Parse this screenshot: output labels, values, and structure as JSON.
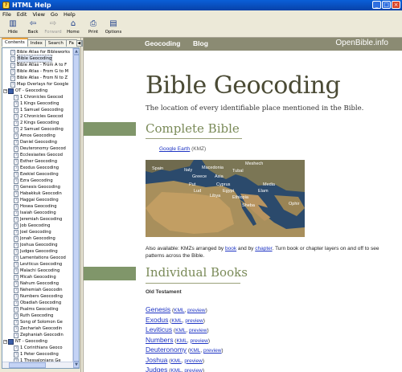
{
  "window": {
    "title": "HTML Help",
    "menu": [
      "File",
      "Edit",
      "View",
      "Go",
      "Help"
    ],
    "toolbar": [
      {
        "label": "Hide",
        "icon": "hide-icon",
        "enabled": true
      },
      {
        "label": "Back",
        "icon": "back-arrow-icon",
        "enabled": true
      },
      {
        "label": "Forward",
        "icon": "forward-arrow-icon",
        "enabled": false
      },
      {
        "label": "Home",
        "icon": "home-icon",
        "enabled": true
      },
      {
        "label": "Print",
        "icon": "printer-icon",
        "enabled": true
      },
      {
        "label": "Options",
        "icon": "options-icon",
        "enabled": true
      }
    ]
  },
  "nav": {
    "tabs": [
      "Contents",
      "Index",
      "Search",
      "Fa"
    ],
    "tree": [
      {
        "label": "Bible Atlas for Bibleworks",
        "type": "page",
        "depth": 1
      },
      {
        "label": "Bible Geocoding",
        "type": "page",
        "depth": 1,
        "selected": true
      },
      {
        "label": "Bible Atlas - From A to F",
        "type": "page",
        "depth": 1
      },
      {
        "label": "Bible Atlas - From G to M",
        "type": "page",
        "depth": 1
      },
      {
        "label": "Bible Atlas - From N to Z",
        "type": "page",
        "depth": 1
      },
      {
        "label": "Map Overlays for Google",
        "type": "page",
        "depth": 1
      },
      {
        "label": "OT - Geocoding",
        "type": "book",
        "depth": 0
      },
      {
        "label": "1 Chronicles Geocod",
        "type": "page",
        "depth": 2
      },
      {
        "label": "1 Kings Geocoding",
        "type": "page",
        "depth": 2
      },
      {
        "label": "1 Samuel Geocoding",
        "type": "page",
        "depth": 2
      },
      {
        "label": "2 Chronicles Geocod",
        "type": "page",
        "depth": 2
      },
      {
        "label": "2 Kings Geocoding",
        "type": "page",
        "depth": 2
      },
      {
        "label": "2 Samuel Geocoding",
        "type": "page",
        "depth": 2
      },
      {
        "label": "Amos Geocoding",
        "type": "page",
        "depth": 2
      },
      {
        "label": "Daniel Geocoding",
        "type": "page",
        "depth": 2
      },
      {
        "label": "Deuteronomy Geocod",
        "type": "page",
        "depth": 2
      },
      {
        "label": "Ecclesiastes Geocod",
        "type": "page",
        "depth": 2
      },
      {
        "label": "Esther Geocoding",
        "type": "page",
        "depth": 2
      },
      {
        "label": "Exodus Geocoding",
        "type": "page",
        "depth": 2
      },
      {
        "label": "Ezekiel Geocoding",
        "type": "page",
        "depth": 2
      },
      {
        "label": "Ezra Geocoding",
        "type": "page",
        "depth": 2
      },
      {
        "label": "Genesis Geocoding",
        "type": "page",
        "depth": 2
      },
      {
        "label": "Habakkuk Geocodin",
        "type": "page",
        "depth": 2
      },
      {
        "label": "Haggai Geocoding",
        "type": "page",
        "depth": 2
      },
      {
        "label": "Hosea Geocoding",
        "type": "page",
        "depth": 2
      },
      {
        "label": "Isaiah Geocoding",
        "type": "page",
        "depth": 2
      },
      {
        "label": "Jeremiah Geocoding",
        "type": "page",
        "depth": 2
      },
      {
        "label": "Job Geocoding",
        "type": "page",
        "depth": 2
      },
      {
        "label": "Joel Geocoding",
        "type": "page",
        "depth": 2
      },
      {
        "label": "Jonah Geocoding",
        "type": "page",
        "depth": 2
      },
      {
        "label": "Joshua Geocoding",
        "type": "page",
        "depth": 2
      },
      {
        "label": "Judges Geocoding",
        "type": "page",
        "depth": 2
      },
      {
        "label": "Lamentations Geocod",
        "type": "page",
        "depth": 2
      },
      {
        "label": "Leviticus Geocoding",
        "type": "page",
        "depth": 2
      },
      {
        "label": "Malachi Geocoding",
        "type": "page",
        "depth": 2
      },
      {
        "label": "Micah Geocoding",
        "type": "page",
        "depth": 2
      },
      {
        "label": "Nahum Geocoding",
        "type": "page",
        "depth": 2
      },
      {
        "label": "Nehemiah Geocodin",
        "type": "page",
        "depth": 2
      },
      {
        "label": "Numbers Geocoding",
        "type": "page",
        "depth": 2
      },
      {
        "label": "Obadiah Geocoding",
        "type": "page",
        "depth": 2
      },
      {
        "label": "Psalms Geocoding",
        "type": "page",
        "depth": 2
      },
      {
        "label": "Ruth Geocoding",
        "type": "page",
        "depth": 2
      },
      {
        "label": "Song of Solomon Ge",
        "type": "page",
        "depth": 2
      },
      {
        "label": "Zechariah Geocodin",
        "type": "page",
        "depth": 2
      },
      {
        "label": "Zephaniah Geocodin",
        "type": "page",
        "depth": 2
      },
      {
        "label": "NT - Geocoding",
        "type": "book",
        "depth": 0
      },
      {
        "label": "1 Corinthians Geoco",
        "type": "page",
        "depth": 2
      },
      {
        "label": "1 Peter Geocoding",
        "type": "page",
        "depth": 2
      },
      {
        "label": "1 Thessalonians Ge",
        "type": "page",
        "depth": 2
      }
    ]
  },
  "page": {
    "site_nav": [
      "Geocoding",
      "Blog"
    ],
    "brand": "OpenBible.info",
    "title": "Bible Geocoding",
    "lead": "The location of every identifiable place mentioned in the Bible.",
    "section1": "Complete Bible",
    "google_earth_link": "Google Earth",
    "google_earth_suffix": "(KMZ)",
    "map_labels": [
      "Meshech",
      "Spain",
      "Macedonia",
      "Tubal",
      "Italy",
      "Greece",
      "Asia",
      "Put",
      "Cyprus",
      "Lud",
      "Media",
      "Libya",
      "Egypt",
      "Elam",
      "Ethiopia",
      "Sheba",
      "Ophir"
    ],
    "avail_pre": "Also available: KMZs arranged by ",
    "avail_link1": "book",
    "avail_mid": " and by ",
    "avail_link2": "chapter",
    "avail_post": ". Turn book or chapter layers on and off to see patterns across the Bible.",
    "section2": "Individual Books",
    "subsection": "Old Testament",
    "books": [
      "Genesis",
      "Exodus",
      "Leviticus",
      "Numbers",
      "Deuteronomy",
      "Joshua",
      "Judges"
    ],
    "kml_label": "KML",
    "preview_label": "preview"
  },
  "colors": {
    "sitebar": "#8b8b73",
    "section_bar": "#80966a",
    "heading": "#4a4a34",
    "link": "#1f35c4"
  }
}
